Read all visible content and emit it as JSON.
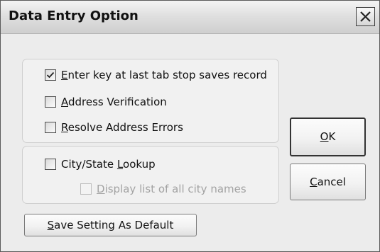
{
  "dialog": {
    "title": "Data Entry Option"
  },
  "options": {
    "enter_key": {
      "mnemonic": "E",
      "rest": "nter key at last tab stop saves record",
      "checked": true
    },
    "address_verification": {
      "mnemonic": "A",
      "rest": "ddress Verification",
      "checked": false
    },
    "resolve_errors": {
      "mnemonic": "R",
      "rest": "esolve Address Errors",
      "checked": false
    },
    "city_state_lookup": {
      "pre": "City/State ",
      "mnemonic": "L",
      "rest": "ookup",
      "checked": false
    },
    "display_city_names": {
      "mnemonic": "D",
      "rest": "isplay list of all city names",
      "checked": false,
      "enabled": false
    }
  },
  "buttons": {
    "ok": {
      "mnemonic": "O",
      "rest": "K"
    },
    "cancel": {
      "mnemonic": "C",
      "rest": "ancel"
    },
    "save_default": {
      "mnemonic": "S",
      "rest": "ave Setting As Default"
    }
  },
  "icons": {
    "close": "close-icon",
    "check": "checkmark-icon"
  }
}
